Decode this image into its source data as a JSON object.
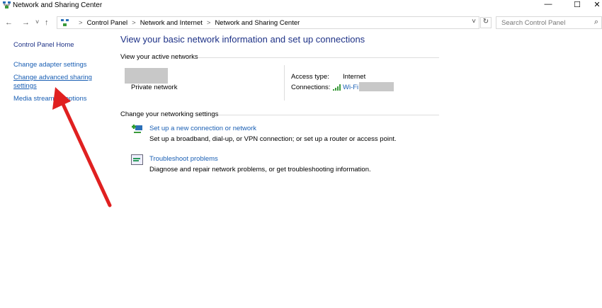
{
  "window": {
    "title": "Network and Sharing Center",
    "minimize": "—",
    "maximize": "☐",
    "close": "✕"
  },
  "nav": {
    "back": "←",
    "forward": "→",
    "recent": "˅",
    "up": "↑",
    "refresh": "↻",
    "dropdown": "˅"
  },
  "breadcrumb": [
    "Control Panel",
    "Network and Internet",
    "Network and Sharing Center"
  ],
  "breadcrumb_sep": ">",
  "search": {
    "placeholder": "Search Control Panel",
    "icon": "⌕"
  },
  "sidebar": {
    "items": [
      {
        "label": "Control Panel Home"
      },
      {
        "label": "Change adapter settings"
      },
      {
        "label": "Change advanced sharing settings"
      },
      {
        "label": "Media streaming options"
      }
    ]
  },
  "main": {
    "heading": "View your basic network information and set up connections",
    "active_networks_label": "View your active networks",
    "network_type": "Private network",
    "access_type_label": "Access type:",
    "access_type_value": "Internet",
    "connections_label": "Connections:",
    "connection_name": "Wi-Fi",
    "change_settings_label": "Change your networking settings",
    "tasks": [
      {
        "title": "Set up a new connection or network",
        "desc": "Set up a broadband, dial-up, or VPN connection; or set up a router or access point."
      },
      {
        "title": "Troubleshoot problems",
        "desc": "Diagnose and repair network problems, or get troubleshooting information."
      }
    ]
  },
  "colors": {
    "link": "#1a5fb4",
    "heading": "#1e3287",
    "arrow": "#e02020"
  }
}
